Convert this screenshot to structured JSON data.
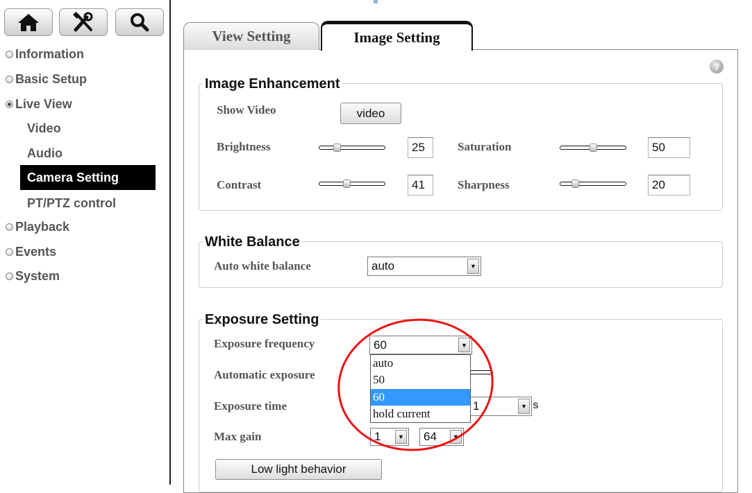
{
  "nav": {
    "top_icons": [
      "home-icon",
      "tools-icon",
      "search-icon"
    ],
    "items": [
      {
        "label": "Information",
        "state": "collapsed"
      },
      {
        "label": "Basic Setup",
        "state": "collapsed"
      },
      {
        "label": "Live View",
        "state": "expanded"
      },
      {
        "label": "Playback",
        "state": "collapsed"
      },
      {
        "label": "Events",
        "state": "collapsed"
      },
      {
        "label": "System",
        "state": "collapsed"
      }
    ],
    "live_view_sub": [
      {
        "label": "Video"
      },
      {
        "label": "Audio"
      },
      {
        "label": "Camera Setting",
        "active": true
      },
      {
        "label": "PT/PTZ control"
      }
    ]
  },
  "tabs": [
    {
      "label": "View Setting",
      "active": false
    },
    {
      "label": "Image Setting",
      "active": true
    }
  ],
  "help_icon": {
    "glyph": "?"
  },
  "image_enhancement": {
    "title": "Image Enhancement",
    "show_video_label": "Show Video",
    "video_button": "video",
    "brightness": {
      "label": "Brightness",
      "value": "25",
      "level": 0.25
    },
    "saturation": {
      "label": "Saturation",
      "value": "50",
      "level": 0.5
    },
    "contrast": {
      "label": "Contrast",
      "value": "41",
      "level": 0.41
    },
    "sharpness": {
      "label": "Sharpness",
      "value": "20",
      "level": 0.2
    }
  },
  "white_balance": {
    "title": "White Balance",
    "label": "Auto white balance",
    "value": "auto"
  },
  "exposure": {
    "title": "Exposure Setting",
    "frequency": {
      "label": "Exposure frequency",
      "value": "60",
      "options": [
        "auto",
        "50",
        "60",
        "hold current"
      ],
      "highlighted": "60"
    },
    "automatic_label": "Automatic exposure",
    "time_label": "Exposure time",
    "time_value": "1",
    "time_unit": "s",
    "max_gain_label": "Max gain",
    "max_gain_min": "1",
    "max_gain_max": "64",
    "low_light_button": "Low light behavior"
  },
  "colors": {
    "active_nav_bg": "#000000",
    "dropdown_highlight": "#3399ff",
    "annotation": "#e11111"
  }
}
